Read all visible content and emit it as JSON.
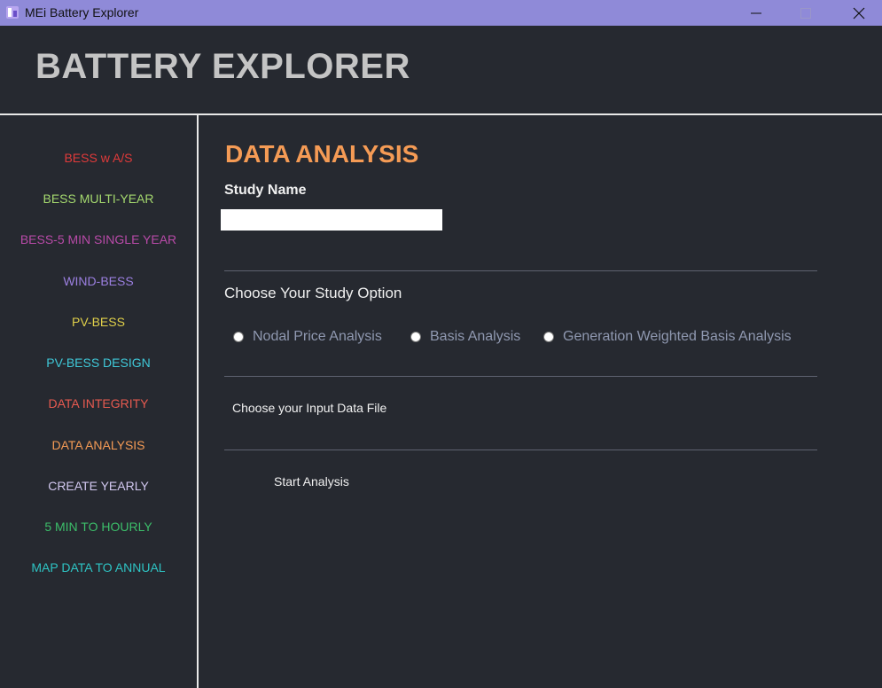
{
  "window": {
    "title": "MEi Battery Explorer",
    "titlebar_color": "#8f8ad8"
  },
  "header": {
    "title": "BATTERY EXPLORER"
  },
  "sidebar": {
    "items": [
      {
        "label": "BESS w A/S",
        "color": "#e03a3a"
      },
      {
        "label": "BESS MULTI-YEAR",
        "color": "#a4d86e"
      },
      {
        "label": "BESS-5 MIN SINGLE YEAR",
        "color": "#b84aa8"
      },
      {
        "label": "WIND-BESS",
        "color": "#9b7fe0"
      },
      {
        "label": "PV-BESS",
        "color": "#e0d04a"
      },
      {
        "label": "PV-BESS DESIGN",
        "color": "#3fc8d8"
      },
      {
        "label": "DATA INTEGRITY",
        "color": "#e85a50"
      },
      {
        "label": "DATA ANALYSIS",
        "color": "#f59b55"
      },
      {
        "label": "CREATE YEARLY",
        "color": "#d2c8f0"
      },
      {
        "label": "5 MIN TO HOURLY",
        "color": "#3cbf6a"
      },
      {
        "label": "MAP DATA TO ANNUAL",
        "color": "#2ec4c4"
      }
    ]
  },
  "main": {
    "section_title": "DATA ANALYSIS",
    "study_name_label": "Study Name",
    "study_name_value": "",
    "study_option_label": "Choose Your Study Option",
    "radio_options": [
      "Nodal Price Analysis",
      "Basis Analysis",
      "Generation Weighted Basis Analysis"
    ],
    "input_file_button": "Choose your Input Data File",
    "start_button": "Start Analysis"
  },
  "icons": {
    "app": "battery-app-icon",
    "minimize": "minimize-icon",
    "maximize": "maximize-icon",
    "close": "close-icon"
  }
}
